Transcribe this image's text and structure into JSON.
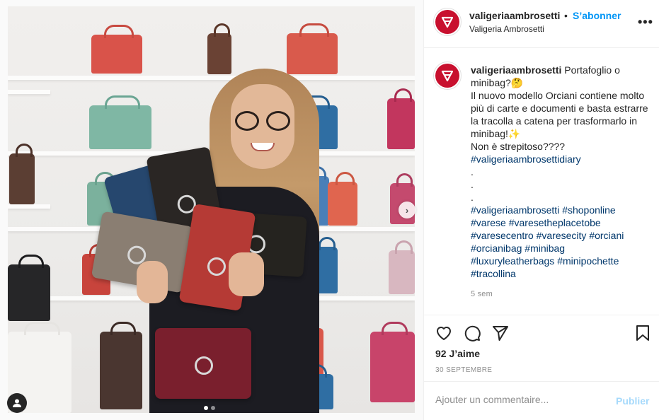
{
  "post": {
    "photo_description_icon": "user-tag-icon",
    "carousel": {
      "current": 1,
      "total": 2
    }
  },
  "header": {
    "username": "valigeriaambrosetti",
    "separator": "•",
    "follow_label": "S’abonner",
    "location": "Valigeria Ambrosetti",
    "more_label": "•••"
  },
  "caption": {
    "username": "valigeriaambrosetti",
    "line1": "Portafoglio o minibag?🤔",
    "line2": "Il nuovo modello Orciani contiene molto più di carte e documenti e basta estrarre la tracolla a catena per trasformarlo in minibag!✨",
    "line3": "Non è strepitoso????",
    "tag_diary": "#valigeriaambrosettidiary",
    "dots": [
      ".",
      ".",
      "."
    ],
    "hashtags": [
      "#valigeriaambrosetti",
      "#shoponline",
      "#varese",
      "#varesetheplacetobe",
      "#varesecentro",
      "#varesecity",
      "#orciani",
      "#orcianibag",
      "#minibag",
      "#luxuryleatherbags",
      "#minipochette",
      "#tracollina"
    ],
    "time": "5 sem"
  },
  "actions": {
    "likes": "92 J’aime",
    "date": "30 SEPTEMBRE"
  },
  "comment": {
    "placeholder": "Ajouter un commentaire...",
    "publish_label": "Publier"
  },
  "colors": {
    "brand_red": "#c8102e",
    "link_blue": "#0095f6",
    "hashtag_blue": "#00376b",
    "muted": "#8e8e8e"
  }
}
